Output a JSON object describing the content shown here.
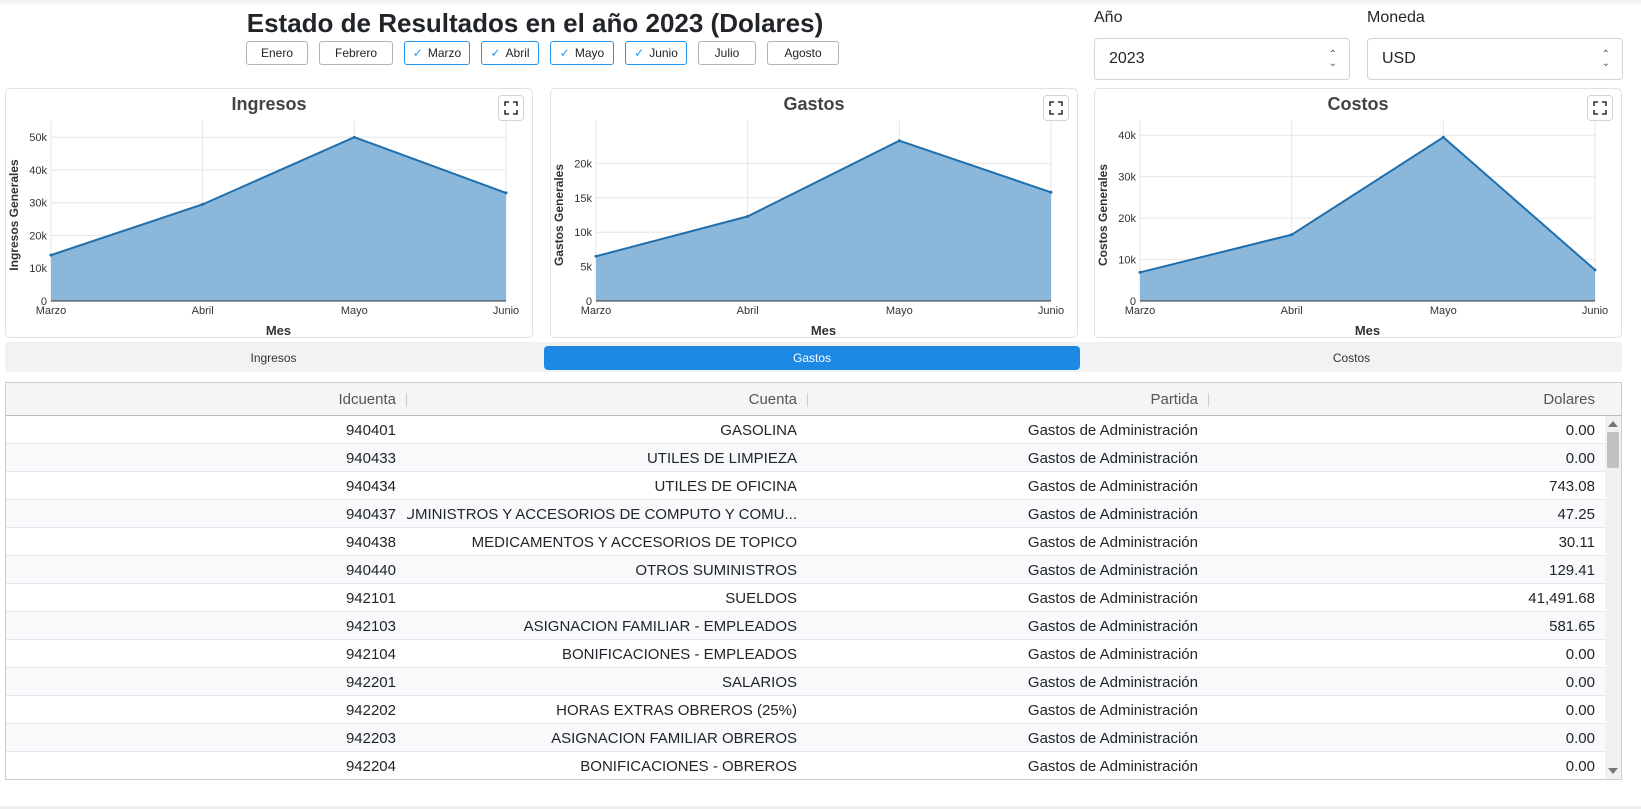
{
  "page_title": "Estado de Resultados en el año 2023 (Dolares)",
  "months": [
    {
      "label": "Enero",
      "checked": false
    },
    {
      "label": "Febrero",
      "checked": false
    },
    {
      "label": "Marzo",
      "checked": true
    },
    {
      "label": "Abril",
      "checked": true
    },
    {
      "label": "Mayo",
      "checked": true
    },
    {
      "label": "Junio",
      "checked": true
    },
    {
      "label": "Julio",
      "checked": false
    },
    {
      "label": "Agosto",
      "checked": false
    }
  ],
  "filters": {
    "year_label": "Año",
    "year_value": "2023",
    "currency_label": "Moneda",
    "currency_value": "USD"
  },
  "colors": {
    "area_fill": "#8ab7da",
    "area_line": "#1f6fad",
    "accent": "#1e88e5"
  },
  "icons": {
    "expand": "fullscreen-icon",
    "check": "check-icon",
    "sort": "select-arrows-icon"
  },
  "chart_data": [
    {
      "type": "area",
      "title": "Ingresos",
      "xlabel": "Mes",
      "ylabel": "Ingresos Generales",
      "categories": [
        "Marzo",
        "Abril",
        "Mayo",
        "Junio"
      ],
      "values": [
        14000,
        29500,
        50000,
        33000
      ],
      "ylim": [
        0,
        52500
      ],
      "yticks": [
        0,
        10000,
        20000,
        30000,
        40000,
        50000
      ],
      "ytick_labels": [
        "0",
        "10k",
        "20k",
        "30k",
        "40k",
        "50k"
      ],
      "grid": true
    },
    {
      "type": "area",
      "title": "Gastos",
      "xlabel": "Mes",
      "ylabel": "Gastos Generales",
      "categories": [
        "Marzo",
        "Abril",
        "Mayo",
        "Junio"
      ],
      "values": [
        6500,
        12300,
        23300,
        15800
      ],
      "ylim": [
        0,
        25000
      ],
      "yticks": [
        0,
        5000,
        10000,
        15000,
        20000
      ],
      "ytick_labels": [
        "0",
        "5k",
        "10k",
        "15k",
        "20k"
      ],
      "grid": true
    },
    {
      "type": "area",
      "title": "Costos",
      "xlabel": "Mes",
      "ylabel": "Costos Generales",
      "categories": [
        "Marzo",
        "Abril",
        "Mayo",
        "Junio"
      ],
      "values": [
        6900,
        16000,
        39500,
        7500
      ],
      "ylim": [
        0,
        41500
      ],
      "yticks": [
        0,
        10000,
        20000,
        30000,
        40000
      ],
      "ytick_labels": [
        "0",
        "10k",
        "20k",
        "30k",
        "40k"
      ],
      "grid": true
    }
  ],
  "tabs": [
    {
      "label": "Ingresos",
      "active": false
    },
    {
      "label": "Gastos",
      "active": true
    },
    {
      "label": "Costos",
      "active": false
    }
  ],
  "table": {
    "columns": [
      "Idcuenta",
      "Cuenta",
      "Partida",
      "Dolares"
    ],
    "rows": [
      [
        "940401",
        "GASOLINA",
        "Gastos de Administración",
        "0.00"
      ],
      [
        "940433",
        "UTILES DE LIMPIEZA",
        "Gastos de Administración",
        "0.00"
      ],
      [
        "940434",
        "UTILES DE OFICINA",
        "Gastos de Administración",
        "743.08"
      ],
      [
        "940437",
        "SUMINISTROS Y ACCESORIOS DE COMPUTO Y COMU...",
        "Gastos de Administración",
        "47.25"
      ],
      [
        "940438",
        "MEDICAMENTOS Y ACCESORIOS DE TOPICO",
        "Gastos de Administración",
        "30.11"
      ],
      [
        "940440",
        "OTROS SUMINISTROS",
        "Gastos de Administración",
        "129.41"
      ],
      [
        "942101",
        "SUELDOS",
        "Gastos de Administración",
        "41,491.68"
      ],
      [
        "942103",
        "ASIGNACION FAMILIAR - EMPLEADOS",
        "Gastos de Administración",
        "581.65"
      ],
      [
        "942104",
        "BONIFICACIONES - EMPLEADOS",
        "Gastos de Administración",
        "0.00"
      ],
      [
        "942201",
        "SALARIOS",
        "Gastos de Administración",
        "0.00"
      ],
      [
        "942202",
        "HORAS EXTRAS OBREROS (25%)",
        "Gastos de Administración",
        "0.00"
      ],
      [
        "942203",
        "ASIGNACION FAMILIAR OBREROS",
        "Gastos de Administración",
        "0.00"
      ],
      [
        "942204",
        "BONIFICACIONES - OBREROS",
        "Gastos de Administración",
        "0.00"
      ]
    ]
  }
}
